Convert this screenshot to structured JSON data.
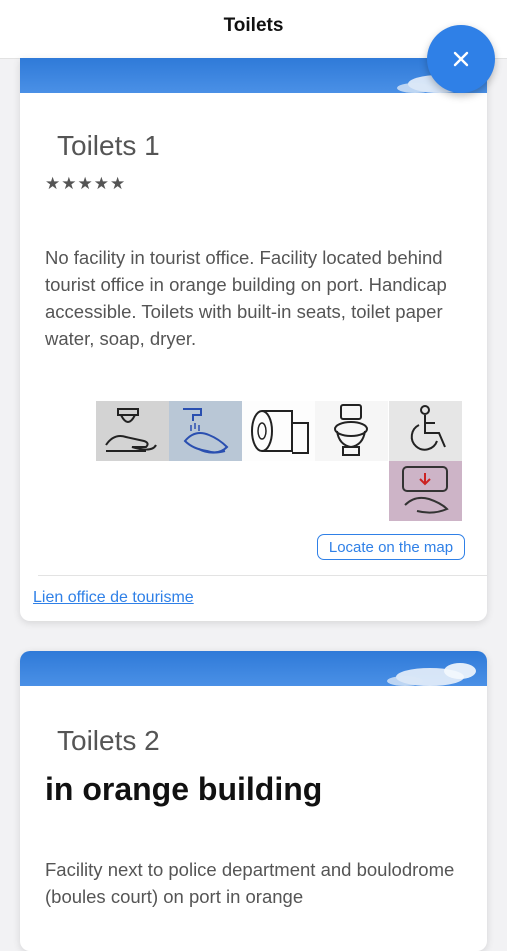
{
  "header": {
    "title": "Toilets"
  },
  "colors": {
    "accent": "#2f80e7",
    "sky": "#3a84e2"
  },
  "close_button": {
    "icon": "close-icon"
  },
  "cards": [
    {
      "title": "Toilets 1",
      "rating": "★★★★★",
      "description": "No facility in tourist office. Facility located behind tourist office in orange building on port. Handicap accessible. Toilets with built-in seats, toilet paper water, soap, dryer.",
      "amenities": [
        "soap-icon",
        "hand-washing-icon",
        "toilet-paper-icon",
        "toilet-icon",
        "wheelchair-icon",
        "hand-dryer-icon"
      ],
      "locate_label": "Locate on the map",
      "link_label": "Lien office de tourisme"
    },
    {
      "title": "Toilets 2",
      "subtitle": "in orange building",
      "description": "Facility next to police department and boulodrome (boules court) on port in orange"
    }
  ]
}
